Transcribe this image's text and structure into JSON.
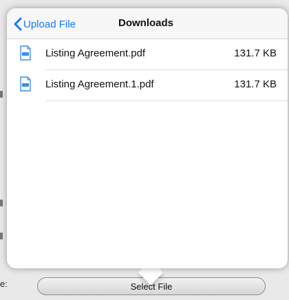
{
  "nav": {
    "back_label": "Upload File",
    "title": "Downloads"
  },
  "files": [
    {
      "name": "Listing Agreement.pdf",
      "size": "131.7 KB",
      "icon": "pdf-file-icon"
    },
    {
      "name": "Listing Agreement.1.pdf",
      "size": "131.7 KB",
      "icon": "pdf-file-icon"
    }
  ],
  "background": {
    "field_label": "e:",
    "select_button_label": "Select File"
  },
  "colors": {
    "accent": "#1479f5",
    "icon_blue": "#3b8ee6"
  }
}
